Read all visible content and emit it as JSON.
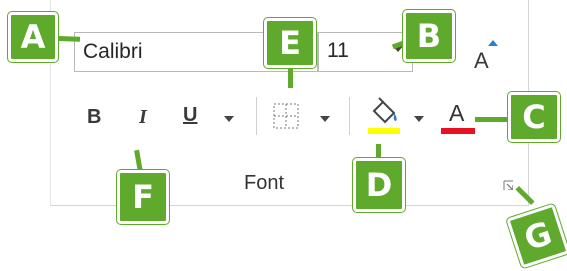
{
  "font_group": {
    "font_name": "Calibri",
    "font_size": "11",
    "grow_font_glyph": "A",
    "bold_label": "B",
    "italic_label": "I",
    "underline_label": "U",
    "font_color_glyph": "A",
    "group_title": "Font"
  },
  "callouts": {
    "a": "A",
    "b": "B",
    "c": "C",
    "d": "D",
    "e": "E",
    "f": "F",
    "g": "G"
  },
  "colors": {
    "callout_green": "#5faa2d",
    "highlight_yellow": "#ffff00",
    "font_color_red": "#e81123"
  },
  "icons": {
    "borders": "borders-icon",
    "highlight": "paint-bucket-icon",
    "launcher": "dialog-launcher-icon"
  }
}
